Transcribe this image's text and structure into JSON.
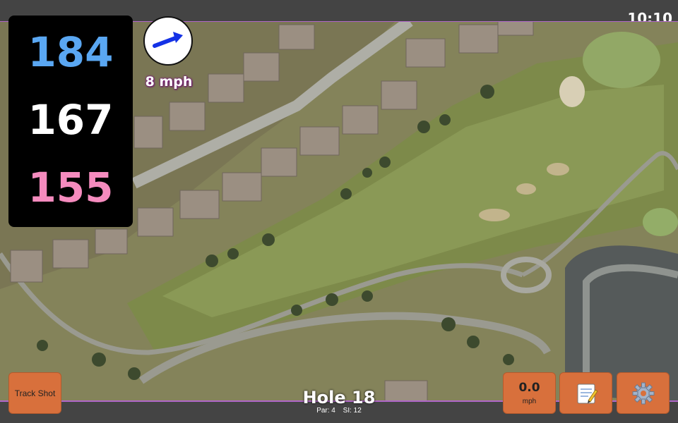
{
  "status": {
    "time": "10:10"
  },
  "distances": {
    "back": "184",
    "middle": "167",
    "front": "155"
  },
  "wind": {
    "speed_label": "8 mph",
    "icon": "wind-direction-arrow-icon"
  },
  "hole": {
    "title": "Hole 18",
    "par": "Par: 4",
    "stroke_index": "SI: 12"
  },
  "buttons": {
    "track_shot": "Track Shot",
    "speed_value": "0.0",
    "speed_unit": "mph",
    "notes_icon": "notepad-icon",
    "settings_icon": "gear-icon"
  },
  "colors": {
    "back_distance": "#5aa7f2",
    "middle_distance": "#ffffff",
    "front_distance": "#f58bbe",
    "button": "#d8703c"
  }
}
